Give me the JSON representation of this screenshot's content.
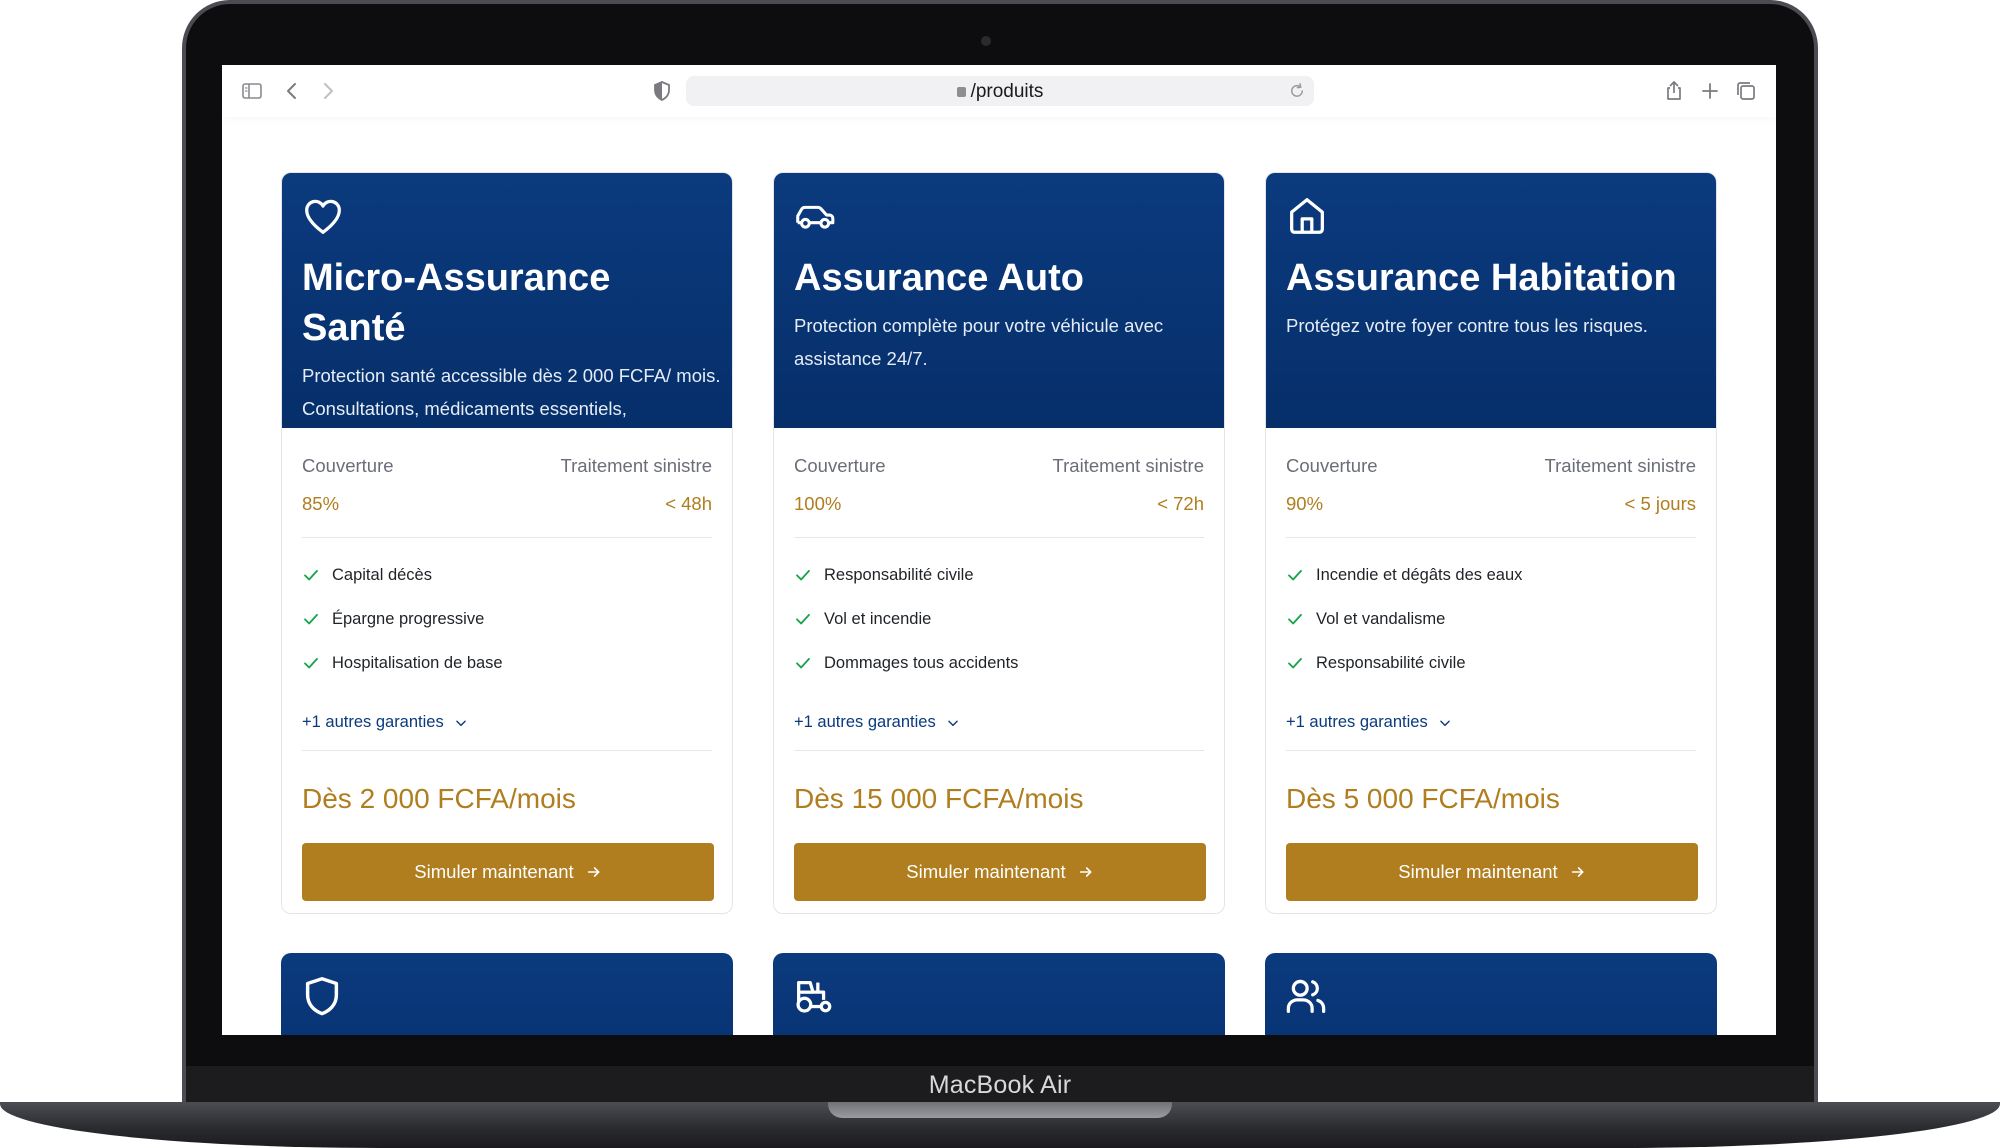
{
  "device": {
    "label": "MacBook Air"
  },
  "browser": {
    "url": "/produits"
  },
  "colors": {
    "primary": "#0b3a7e",
    "accent": "#b07d1f",
    "check": "#16a34a"
  },
  "products": [
    {
      "icon": "heart-icon",
      "title": "Micro-Assurance Santé",
      "description": "Protection santé accessible dès 2 000 FCFA/ mois. Consultations, médicaments essentiels,",
      "coverage_label": "Couverture",
      "coverage_value": "85%",
      "claim_label": "Traitement sinistre",
      "claim_value": "< 48h",
      "features": [
        "Capital décès",
        "Épargne progressive",
        "Hospitalisation de base"
      ],
      "more_label": "+1 autres garanties",
      "price": "Dès 2 000 FCFA/mois",
      "cta": "Simuler maintenant"
    },
    {
      "icon": "car-icon",
      "title": "Assurance Auto",
      "description": "Protection complète pour votre véhicule avec assistance 24/7.",
      "coverage_label": "Couverture",
      "coverage_value": "100%",
      "claim_label": "Traitement sinistre",
      "claim_value": "< 72h",
      "features": [
        "Responsabilité civile",
        "Vol et incendie",
        "Dommages tous accidents"
      ],
      "more_label": "+1 autres garanties",
      "price": "Dès 15 000 FCFA/mois",
      "cta": "Simuler maintenant"
    },
    {
      "icon": "home-icon",
      "title": "Assurance Habitation",
      "description": "Protégez votre foyer contre tous les risques.",
      "coverage_label": "Couverture",
      "coverage_value": "90%",
      "claim_label": "Traitement sinistre",
      "claim_value": "< 5 jours",
      "features": [
        "Incendie et dégâts des eaux",
        "Vol et vandalisme",
        "Responsabilité civile"
      ],
      "more_label": "+1 autres garanties",
      "price": "Dès 5 000 FCFA/mois",
      "cta": "Simuler maintenant"
    }
  ],
  "next_row_icons": [
    "shield-icon",
    "tractor-icon",
    "users-icon"
  ]
}
